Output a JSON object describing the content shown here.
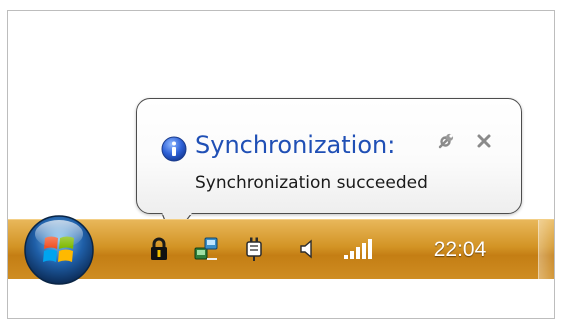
{
  "notification": {
    "title": "Synchronization:",
    "message": "Synchronization succeeded",
    "title_color": "#1f4fb5",
    "info_icon": "info-icon",
    "options_icon": "wrench-icon",
    "close_icon": "close-icon"
  },
  "taskbar": {
    "background": "#d39425",
    "start_icon": "windows-logo-icon",
    "tray_icons": [
      "lock-icon",
      "network-icon",
      "power-plug-icon",
      "speaker-icon",
      "signal-strength-icon"
    ],
    "clock": "22:04"
  }
}
